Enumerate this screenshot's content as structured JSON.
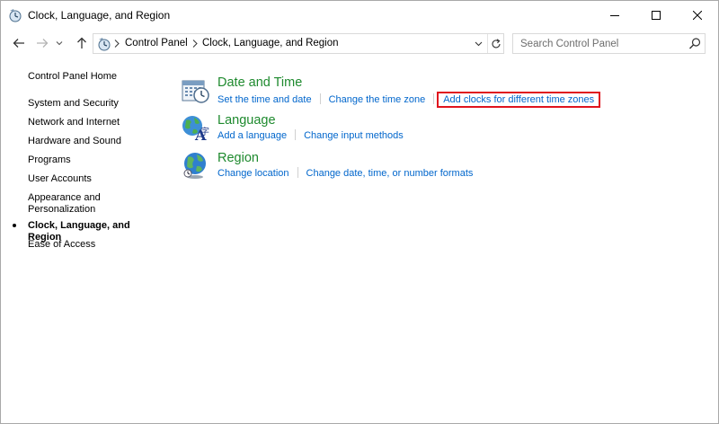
{
  "window": {
    "title": "Clock, Language, and Region"
  },
  "address_bar": {
    "breadcrumbs": [
      "Control Panel",
      "Clock, Language, and Region"
    ]
  },
  "search": {
    "placeholder": "Search Control Panel"
  },
  "sidebar": {
    "items": [
      {
        "label": "Control Panel Home"
      },
      {
        "label": "System and Security"
      },
      {
        "label": "Network and Internet"
      },
      {
        "label": "Hardware and Sound"
      },
      {
        "label": "Programs"
      },
      {
        "label": "User Accounts"
      },
      {
        "label": "Appearance and\nPersonalization"
      },
      {
        "label": "Clock, Language, and Region",
        "current": true
      },
      {
        "label": "Ease of Access"
      }
    ]
  },
  "categories": [
    {
      "title": "Date and Time",
      "icon": "calendar-clock-icon",
      "links": [
        "Set the time and date",
        "Change the time zone",
        "Add clocks for different time zones"
      ],
      "highlighted_link": "Add clocks for different time zones",
      "highlight_color": "#e0141e"
    },
    {
      "title": "Language",
      "icon": "language-globe-icon",
      "links": [
        "Add a language",
        "Change input methods"
      ]
    },
    {
      "title": "Region",
      "icon": "region-globe-icon",
      "links": [
        "Change location",
        "Change date, time, or number formats"
      ]
    }
  ],
  "colors": {
    "category_title": "#1e8a2e",
    "link": "#0066cc"
  }
}
